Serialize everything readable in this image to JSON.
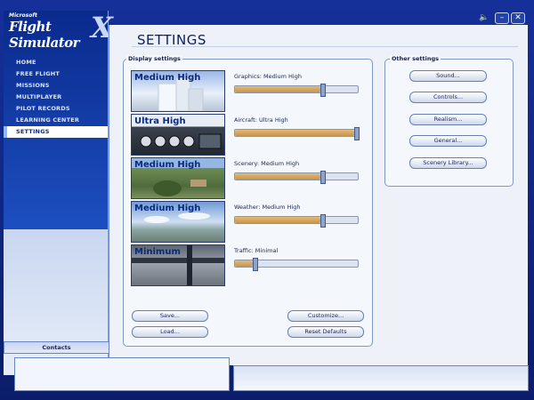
{
  "app": {
    "logo_small": "Microsoft",
    "logo_main": "Flight Simulator",
    "logo_x": "X"
  },
  "window_controls": {
    "sound": "🔈",
    "minimize": "–",
    "close": "✕"
  },
  "nav": {
    "items": [
      {
        "label": "HOME",
        "active": false
      },
      {
        "label": "FREE FLIGHT",
        "active": false
      },
      {
        "label": "MISSIONS",
        "active": false
      },
      {
        "label": "MULTIPLAYER",
        "active": false
      },
      {
        "label": "PILOT RECORDS",
        "active": false
      },
      {
        "label": "LEARNING CENTER",
        "active": false
      },
      {
        "label": "SETTINGS",
        "active": true
      }
    ]
  },
  "page": {
    "title": "SETTINGS"
  },
  "display_settings": {
    "label": "Display settings",
    "rows": [
      {
        "preview_label": "Medium High",
        "setting_label": "Graphics: Medium High",
        "level": 0.72
      },
      {
        "preview_label": "Ultra High",
        "setting_label": "Aircraft: Ultra High",
        "level": 1.0
      },
      {
        "preview_label": "Medium High",
        "setting_label": "Scenery: Medium High",
        "level": 0.72
      },
      {
        "preview_label": "Medium High",
        "setting_label": "Weather: Medium High",
        "level": 0.72
      },
      {
        "preview_label": "Minimum",
        "setting_label": "Traffic: Minimal",
        "level": 0.15
      }
    ],
    "buttons": {
      "save": "Save...",
      "load": "Load...",
      "customize": "Customize...",
      "reset": "Reset Defaults"
    }
  },
  "other_settings": {
    "label": "Other settings",
    "buttons": [
      "Sound...",
      "Controls...",
      "Realism...",
      "General...",
      "Scenery Library..."
    ]
  },
  "contacts": {
    "label": "Contacts"
  }
}
